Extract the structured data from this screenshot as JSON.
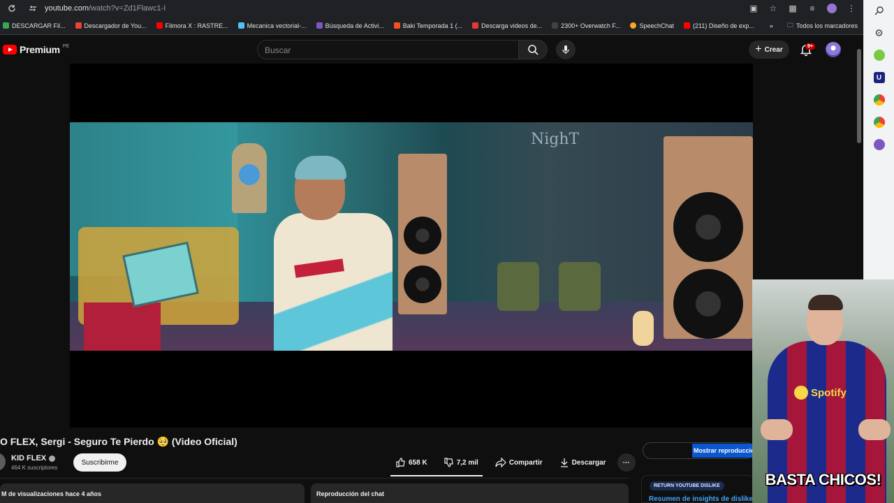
{
  "browser": {
    "url_host": "youtube.com",
    "url_path": "/watch?v=Zd1Flawc1-I",
    "bookmarks": [
      {
        "label": "DESCARGAR Fil...",
        "color": "#34a853"
      },
      {
        "label": "Descargador de You...",
        "color": "#ea4335"
      },
      {
        "label": "Filmora X : RASTRE...",
        "color": "#ff0000"
      },
      {
        "label": "Mecanica vectorial-...",
        "color": "#4fc3f7"
      },
      {
        "label": "Búsqueda de Activi...",
        "color": "#7e57c2"
      },
      {
        "label": "Baki Temporada 1 (...",
        "color": "#f4511e"
      },
      {
        "label": "Descarga videos de...",
        "color": "#e53935"
      },
      {
        "label": "2300+ Overwatch F...",
        "color": "#424242"
      },
      {
        "label": "SpeechChat",
        "color": "#f9a825"
      },
      {
        "label": "(211) Diseño de exp...",
        "color": "#ff0000"
      }
    ],
    "all_bookmarks_label": "Todos los marcadores"
  },
  "youtube": {
    "logo_text": "Premium",
    "country_code": "PE",
    "search_placeholder": "Buscar",
    "create_label": "Crear",
    "notif_badge": "9+"
  },
  "video": {
    "title": "O FLEX, Sergi - Seguro Te Pierdo 🥺 (Video Oficial)",
    "channel": "KID FLEX",
    "subscribers": "464 K suscriptores",
    "subscribe_label": "Suscribirme",
    "likes": "658 K",
    "dislikes": "7,2 mil",
    "share_label": "Compartir",
    "download_label": "Descargar",
    "description_meta": "M de visualizaciones  hace 4 años",
    "chat_replay_label": "Reproducción del chat",
    "show_replay_label": "Mostrar reproducción",
    "ryd_tag": "RETURN YOUTUBE DISLIKE",
    "ryd_title": "Resumen de insights de dislikes",
    "neon_sign": "NighT"
  },
  "webcam": {
    "sponsor_text": "Spotify",
    "caption": "BASTA CHICOS!"
  },
  "colors": {
    "yt_red": "#ff0000",
    "accent_blue": "#0b57d0",
    "bg": "#0f0f0f"
  }
}
